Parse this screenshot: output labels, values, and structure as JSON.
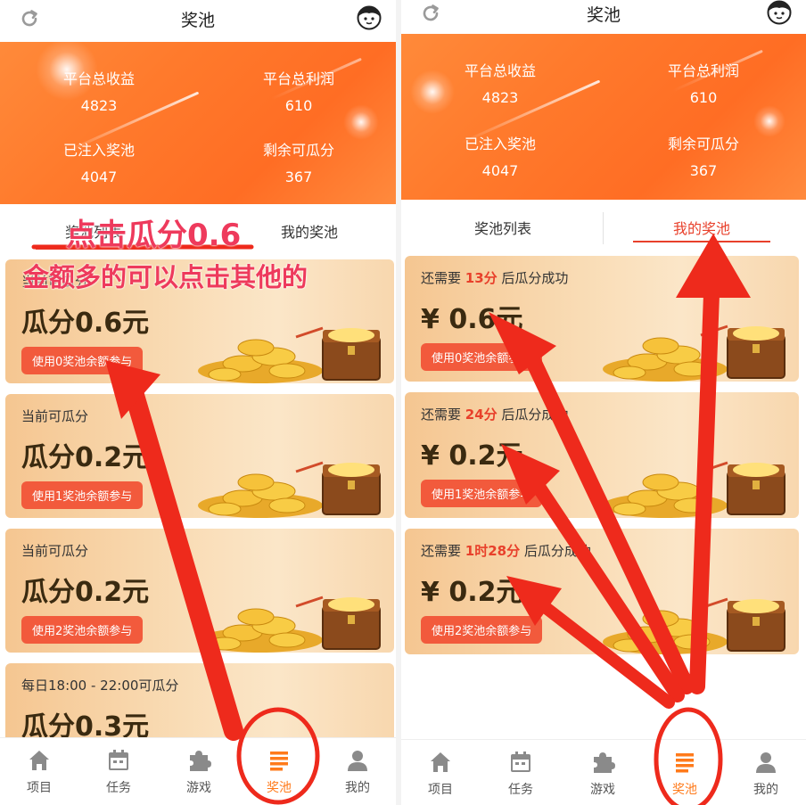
{
  "left": {
    "header": {
      "title": "奖池"
    },
    "stats": [
      {
        "label": "平台总收益",
        "value": "4823"
      },
      {
        "label": "平台总利润",
        "value": "610"
      },
      {
        "label": "已注入奖池",
        "value": "4047"
      },
      {
        "label": "剩余可瓜分",
        "value": "367"
      }
    ],
    "tabs": [
      {
        "label": "奖池列表"
      },
      {
        "label": "我的奖池"
      }
    ],
    "cards": [
      {
        "subtitle": "当前可瓜分",
        "amount": "瓜分0.6元",
        "button": "使用0奖池余额参与"
      },
      {
        "subtitle": "当前可瓜分",
        "amount": "瓜分0.2元",
        "button": "使用1奖池余额参与"
      },
      {
        "subtitle": "当前可瓜分",
        "amount": "瓜分0.2元",
        "button": "使用2奖池余额参与"
      },
      {
        "subtitle": "每日18:00 - 22:00可瓜分",
        "amount": "瓜分0.3元",
        "button": ""
      }
    ],
    "nav": [
      {
        "label": "项目",
        "icon": "home-icon"
      },
      {
        "label": "任务",
        "icon": "calendar-icon"
      },
      {
        "label": "游戏",
        "icon": "puzzle-icon"
      },
      {
        "label": "奖池",
        "icon": "list-icon"
      },
      {
        "label": "我的",
        "icon": "user-icon"
      }
    ],
    "active_nav": 3
  },
  "right": {
    "header": {
      "title": "奖池"
    },
    "stats": [
      {
        "label": "平台总收益",
        "value": "4823"
      },
      {
        "label": "平台总利润",
        "value": "610"
      },
      {
        "label": "已注入奖池",
        "value": "4047"
      },
      {
        "label": "剩余可瓜分",
        "value": "367"
      }
    ],
    "tabs": [
      {
        "label": "奖池列表"
      },
      {
        "label": "我的奖池"
      }
    ],
    "cards": [
      {
        "prefix": "还需要 ",
        "wait": "13分",
        "suffix": " 后瓜分成功",
        "amount": "¥ 0.6元",
        "button": "使用0奖池余额参与"
      },
      {
        "prefix": "还需要 ",
        "wait": "24分",
        "suffix": " 后瓜分成功",
        "amount": "¥ 0.2元",
        "button": "使用1奖池余额参与"
      },
      {
        "prefix": "还需要 ",
        "wait": "1时28分",
        "suffix": " 后瓜分成功",
        "amount": "¥ 0.2元",
        "button": "使用2奖池余额参与"
      }
    ],
    "nav": [
      {
        "label": "项目",
        "icon": "home-icon"
      },
      {
        "label": "任务",
        "icon": "calendar-icon"
      },
      {
        "label": "游戏",
        "icon": "puzzle-icon"
      },
      {
        "label": "奖池",
        "icon": "list-icon"
      },
      {
        "label": "我的",
        "icon": "user-icon"
      }
    ],
    "active_nav": 3
  },
  "annotations": {
    "line1": "点击瓜分0.6",
    "line2": "金额多的可以点击其他的"
  },
  "colors": {
    "accent": "#ff7a1a",
    "banner": "#ff7a2c",
    "button": "#f25a3c",
    "highlight": "#e8402b",
    "annotation_text": "#ee3a5c",
    "annotation_arrow": "#ee2a1c"
  }
}
